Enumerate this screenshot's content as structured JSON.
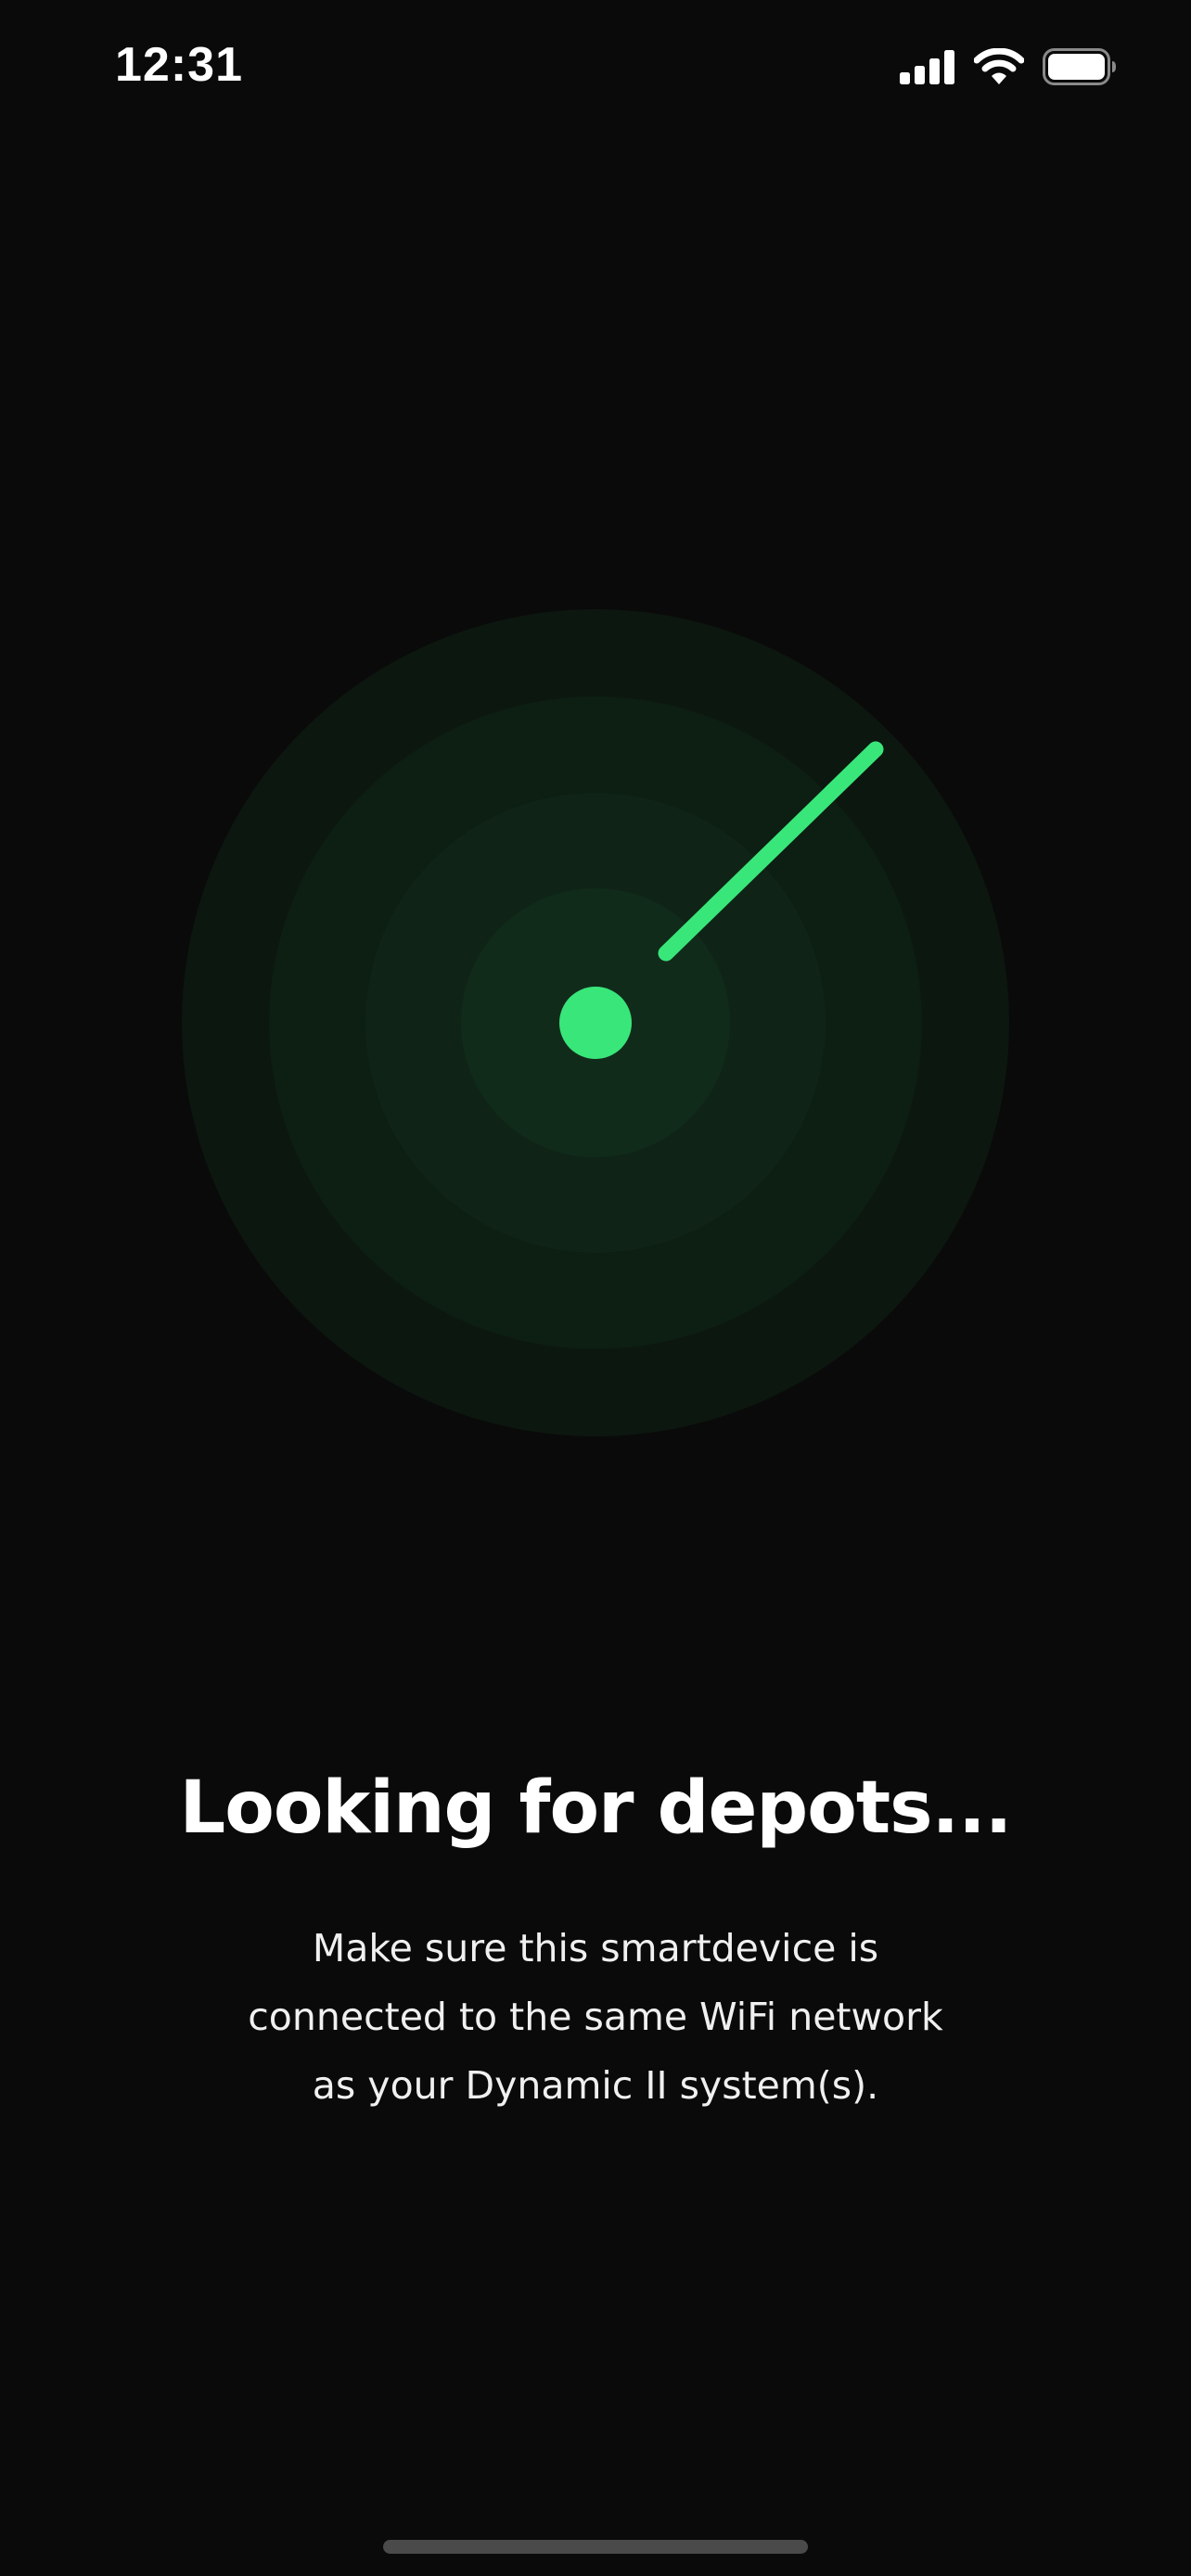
{
  "status_bar": {
    "time": "12:31",
    "icons": [
      "signal-icon",
      "wifi-icon",
      "battery-icon"
    ]
  },
  "radar": {
    "colors": {
      "background": "#0a0a0a",
      "ring_outer": "#0c170f",
      "ring_2": "#0d1e13",
      "ring_3": "#0f2416",
      "ring_inner": "#112b1b",
      "accent": "#39e67a"
    }
  },
  "main": {
    "title": "Looking for depots...",
    "subtitle_lines": [
      "Make sure this smartdevice is",
      "connected to the same WiFi network",
      "as your Dynamic II system(s)."
    ]
  }
}
